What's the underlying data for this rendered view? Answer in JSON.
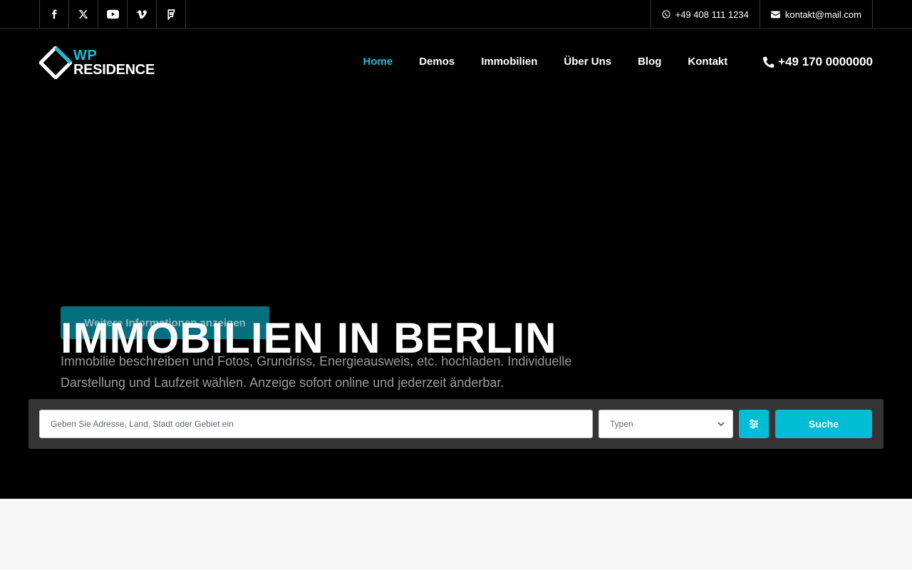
{
  "topbar": {
    "social": [
      {
        "icon": "facebook-icon"
      },
      {
        "icon": "x-twitter-icon"
      },
      {
        "icon": "youtube-icon"
      },
      {
        "icon": "vimeo-icon"
      },
      {
        "icon": "foursquare-icon"
      }
    ],
    "whatsapp": "+49 408 111 1234",
    "email": "kontakt@mail.com"
  },
  "header": {
    "logo": {
      "line1": "WP",
      "line2": "RESIDENCE"
    },
    "nav": [
      {
        "label": "Home",
        "active": true
      },
      {
        "label": "Demos"
      },
      {
        "label": "Immobilien"
      },
      {
        "label": "Über Uns"
      },
      {
        "label": "Blog"
      },
      {
        "label": "Kontakt"
      }
    ],
    "phone": "+49 170 0000000"
  },
  "hero": {
    "button": "Weitere Informationen anzeigen",
    "title": "IMMOBILIEN IN BERLIN",
    "description": "Immobilie beschreiben und Fotos, Grundriss, Energieausweis, etc. hochladen. Individuelle Darstellung und Laufzeit wählen. Anzeige sofort online und jederzeit änderbar."
  },
  "search": {
    "placeholder": "Geben Sie Adresse, Land, Stadt oder Gebiet ein",
    "type_select": "Typen",
    "button": "Suche"
  },
  "colors": {
    "accent": "#00bcd4",
    "hero_bg": "#000000",
    "search_bg": "#343434"
  }
}
